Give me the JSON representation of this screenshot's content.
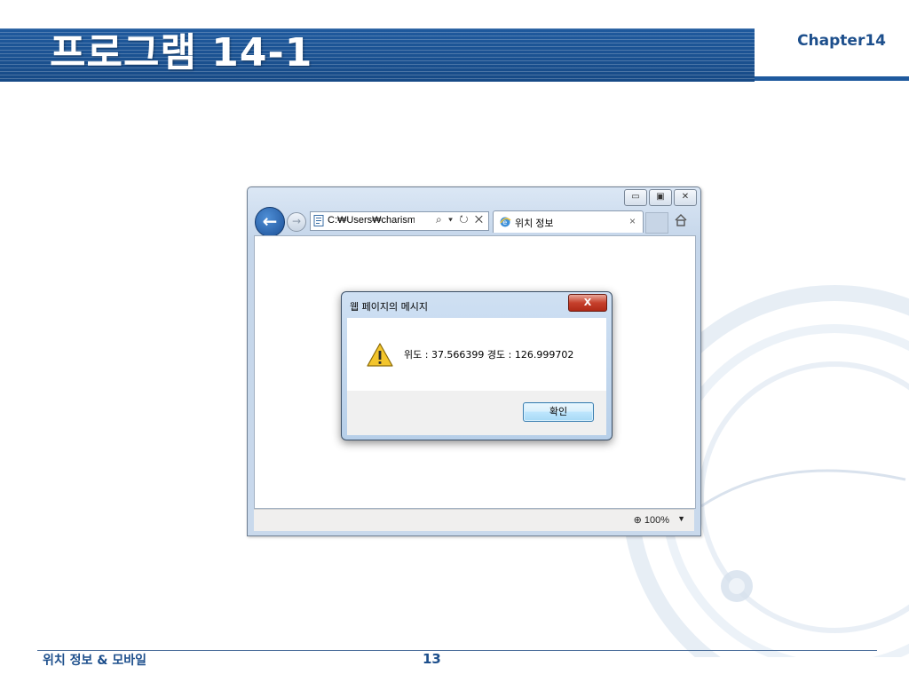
{
  "slide": {
    "title": "프로그램 14-1",
    "chapter": "Chapter14",
    "footer_topic": "위치 정보 & 모바일",
    "page_number": "13"
  },
  "browser": {
    "address_text": "C:₩Users₩charisma",
    "address_tools": "⌕ ▾ ↻ ✕",
    "tab_title": "위치 정보",
    "tab_close": "×",
    "window_buttons": {
      "minimize": "▭",
      "maximize": "▣",
      "close": "✕"
    },
    "zoom": "100%",
    "zoom_dropdown": "▼",
    "colors": {
      "frame": "#c5d6ea",
      "accent": "#1b4f96"
    },
    "icons": [
      "back-arrow-icon",
      "forward-arrow-icon",
      "page-icon",
      "ie-icon",
      "home-icon",
      "zoom-icon"
    ]
  },
  "dialog": {
    "title": "웹 페이지의 메시지",
    "close_label": "X",
    "message": "위도 : 37.566399 경도 : 126.999702",
    "ok_label": "확인",
    "icon": "warning-icon"
  }
}
